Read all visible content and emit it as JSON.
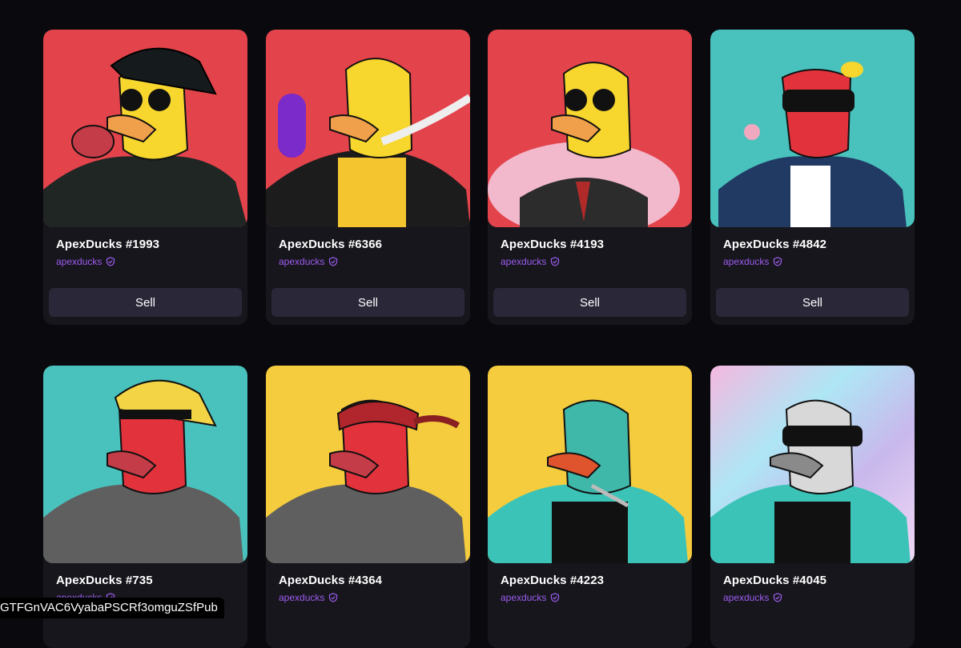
{
  "cards": [
    {
      "title": "ApexDucks #1993",
      "creator": "apexducks",
      "action": "Sell",
      "bg": "#e3434b"
    },
    {
      "title": "ApexDucks #6366",
      "creator": "apexducks",
      "action": "Sell",
      "bg": "#e3434b"
    },
    {
      "title": "ApexDucks #4193",
      "creator": "apexducks",
      "action": "Sell",
      "bg": "#e3434b"
    },
    {
      "title": "ApexDucks #4842",
      "creator": "apexducks",
      "action": "Sell",
      "bg": "#49c2bd"
    },
    {
      "title": "ApexDucks #735",
      "creator": "apexducks",
      "bg": "#49c2bd"
    },
    {
      "title": "ApexDucks #4364",
      "creator": "apexducks",
      "bg": "#f5cc3d"
    },
    {
      "title": "ApexDucks #4223",
      "creator": "apexducks",
      "bg": "#f5cc3d"
    },
    {
      "title": "ApexDucks #4045",
      "creator": "apexducks",
      "bg": "#c9b8ec"
    }
  ],
  "tooltip": "GTFGnVAC6VyabaPSCRf3omguZSfPub",
  "colors": {
    "page_bg": "#0a0a0e",
    "card_bg": "#16161c",
    "button_bg": "#2a2838",
    "accent_purple": "#9d5cf0"
  }
}
